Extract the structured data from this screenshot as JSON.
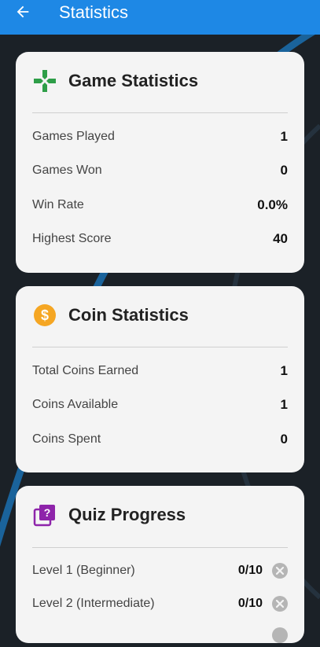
{
  "app_bar": {
    "title": "Statistics",
    "back_icon": "arrow-back-icon",
    "background": "#1e88e5"
  },
  "game_statistics": {
    "title": "Game Statistics",
    "icon": "gamepad-icon",
    "icon_color": "#2e9e48",
    "rows": [
      {
        "label": "Games Played",
        "value": "1"
      },
      {
        "label": "Games Won",
        "value": "0"
      },
      {
        "label": "Win Rate",
        "value": "0.0%"
      },
      {
        "label": "Highest Score",
        "value": "40"
      }
    ]
  },
  "coin_statistics": {
    "title": "Coin Statistics",
    "icon": "dollar-coin-icon",
    "icon_color": "#f5a623",
    "rows": [
      {
        "label": "Total Coins Earned",
        "value": "1"
      },
      {
        "label": "Coins Available",
        "value": "1"
      },
      {
        "label": "Coins Spent",
        "value": "0"
      }
    ]
  },
  "quiz_progress": {
    "title": "Quiz Progress",
    "icon": "quiz-icon",
    "icon_color": "#8e24aa",
    "rows": [
      {
        "label": "Level 1 (Beginner)",
        "value": "0/10",
        "status_icon": "cancel-icon"
      },
      {
        "label": "Level 2 (Intermediate)",
        "value": "0/10",
        "status_icon": "cancel-icon"
      }
    ]
  }
}
